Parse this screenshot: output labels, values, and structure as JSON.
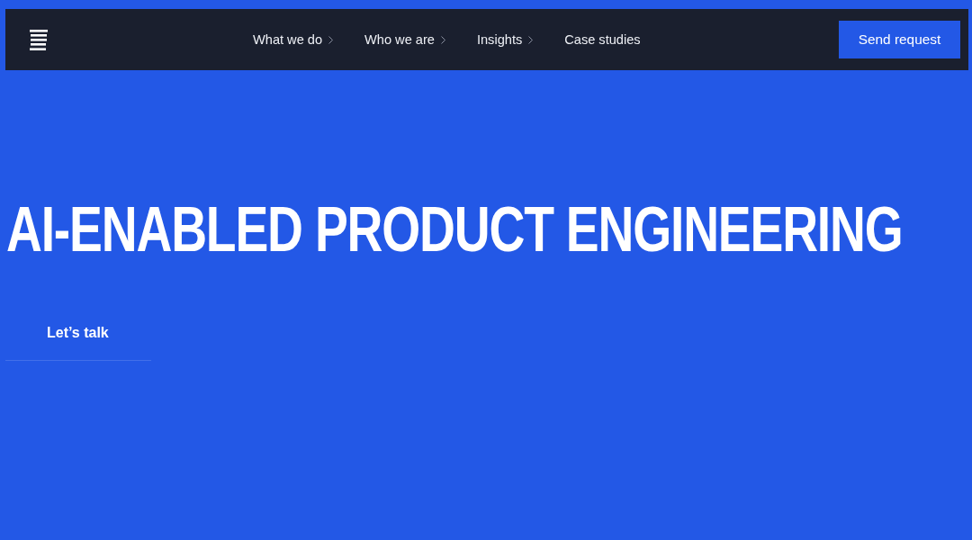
{
  "header": {
    "nav": [
      {
        "label": "What we do",
        "kind": "menu"
      },
      {
        "label": "Who we are",
        "kind": "menu"
      },
      {
        "label": "Insights",
        "kind": "menu"
      },
      {
        "label": "Case studies",
        "kind": "link"
      }
    ],
    "cta": "Send request"
  },
  "hero": {
    "title": "AI-ENABLED PRODUCT ENGINEERING",
    "link": "Let’s talk"
  }
}
